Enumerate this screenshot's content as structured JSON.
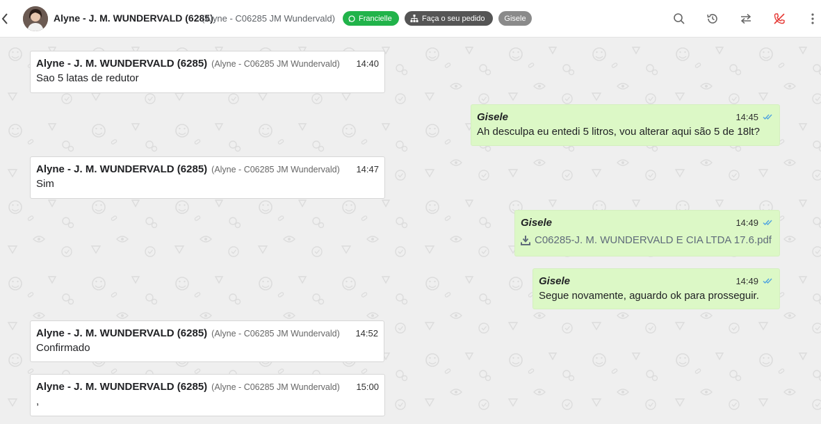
{
  "header": {
    "contact_name": "Alyne - J. M. WUNDERVALD (6285)",
    "contact_sub": "(Alyne - C06285 JM Wundervald)",
    "tags": {
      "whatsapp": "Francielle",
      "order": "Faça o seu pedido",
      "agent": "Gisele"
    },
    "icons": [
      "back-icon",
      "search-icon",
      "history-icon",
      "transfer-icon",
      "end-call-icon",
      "more-vert-icon"
    ]
  },
  "colors": {
    "whatsapp_tag": "#21b34a",
    "order_tag": "#555555",
    "agent_tag": "#8a8a8a",
    "outgoing_bubble": "#dcf8c6",
    "incoming_bubble": "#ffffff",
    "read_ticks": "#4fa3e0",
    "end_call": "#e53935"
  },
  "messages": [
    {
      "direction": "in",
      "sender": "Alyne - J. M. WUNDERVALD (6285)",
      "sender_sub": "(Alyne - C06285 JM Wundervald)",
      "time": "14:40",
      "text": "Sao 5 latas de redutor"
    },
    {
      "direction": "out",
      "sender": "Gisele",
      "time": "14:45",
      "text": "Ah desculpa eu entedi 5 litros, vou alterar aqui são 5 de 18lt?",
      "status": "read"
    },
    {
      "direction": "in",
      "sender": "Alyne - J. M. WUNDERVALD (6285)",
      "sender_sub": "(Alyne - C06285 JM Wundervald)",
      "time": "14:47",
      "text": "Sim"
    },
    {
      "direction": "out",
      "sender": "Gisele",
      "time": "14:49",
      "attachment": "C06285-J. M. WUNDERVALD E CIA LTDA 17.6.pdf",
      "status": "read"
    },
    {
      "direction": "out",
      "sender": "Gisele",
      "time": "14:49",
      "text": "Segue novamente, aguardo ok para prosseguir.",
      "status": "read"
    },
    {
      "direction": "in",
      "sender": "Alyne - J. M. WUNDERVALD (6285)",
      "sender_sub": "(Alyne - C06285 JM Wundervald)",
      "time": "14:52",
      "text": "Confirmado"
    },
    {
      "direction": "in",
      "sender": "Alyne - J. M. WUNDERVALD (6285)",
      "sender_sub": "(Alyne - C06285 JM Wundervald)",
      "time": "15:00",
      "text": ","
    }
  ]
}
